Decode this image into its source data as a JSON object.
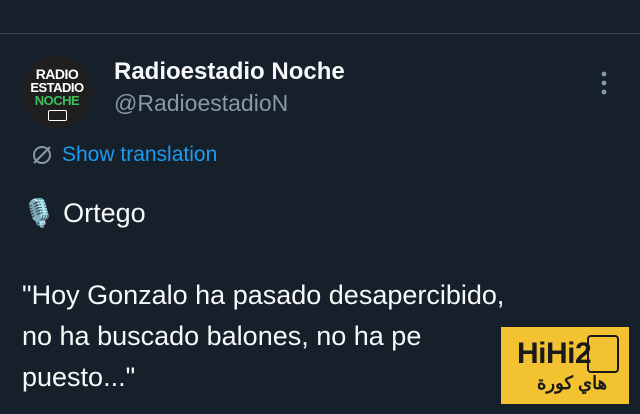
{
  "author": {
    "display_name": "Radioestadio Noche",
    "handle": "@RadioestadioN",
    "avatar": {
      "line1": "RADIO",
      "line2": "ESTADIO",
      "line3": "NOCHE"
    }
  },
  "actions": {
    "more_icon": "more-vertical-icon",
    "translate_icon": "globe-icon",
    "translate_label": "Show translation"
  },
  "tweet": {
    "speaker_icon": "microphone-emoji",
    "speaker": "Ortego",
    "lines": [
      "\"Hoy Gonzalo ha pasado desapercibido,",
      "no ha buscado balones, no ha pe",
      "puesto...\""
    ]
  },
  "watermark": {
    "main": "HiHi2",
    "sub": "هاي كورة"
  },
  "colors": {
    "background": "#15202b",
    "link": "#1d9bf0",
    "secondary_text": "#8b98a5",
    "watermark_bg": "#f2c230"
  }
}
